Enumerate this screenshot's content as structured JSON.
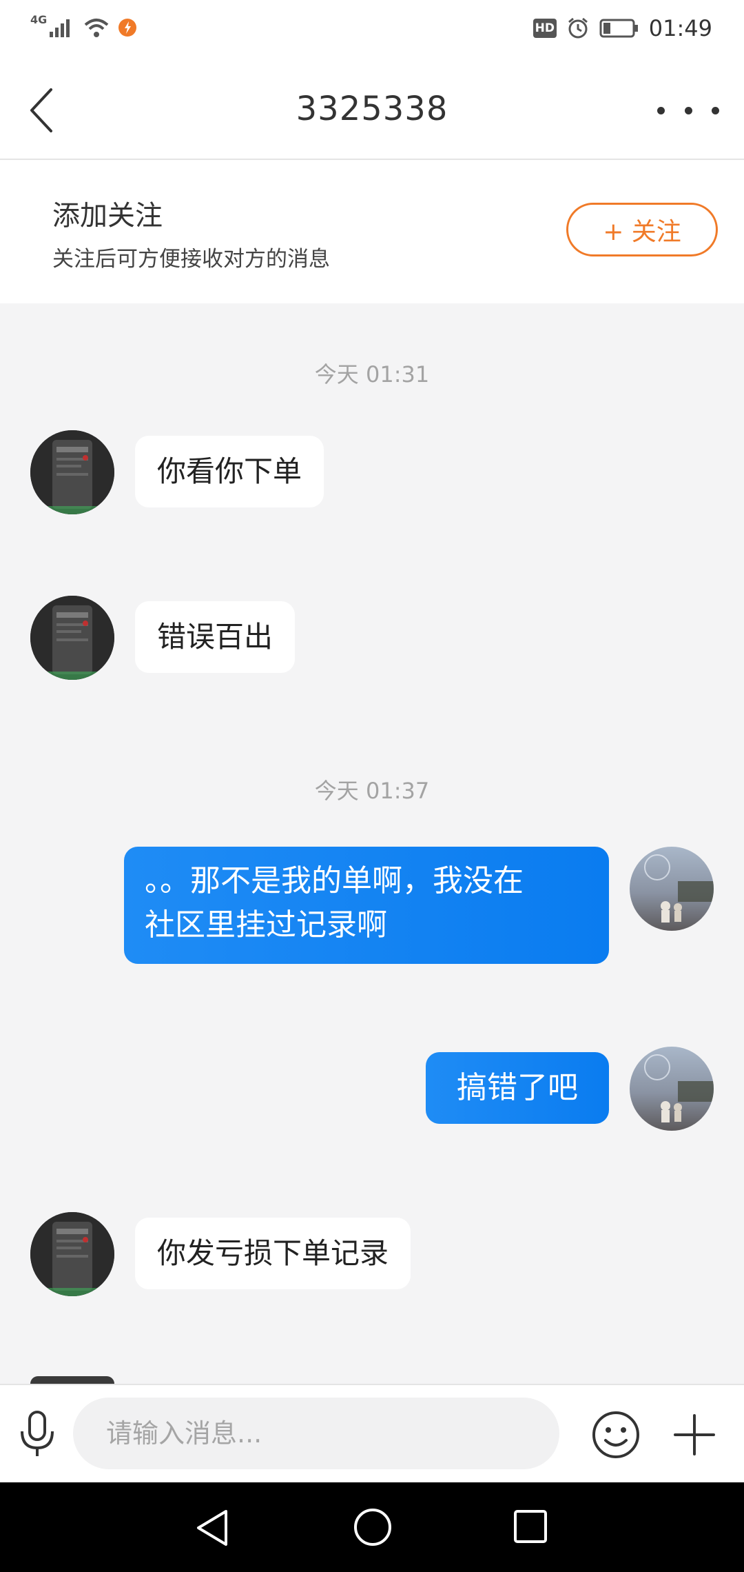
{
  "status_bar": {
    "network": "4G",
    "hd_badge": "HD",
    "time": "01:49",
    "icons": [
      "signal-icon",
      "wifi-icon",
      "app-notification-icon",
      "alarm-icon",
      "battery-icon"
    ]
  },
  "header": {
    "title": "3325338",
    "icons": [
      "back-arrow-icon",
      "more-options-icon"
    ]
  },
  "follow_panel": {
    "title": "添加关注",
    "subtitle": "关注后可方便接收对方的消息",
    "button_label": "+ 关注",
    "accent_color": "#f07a28"
  },
  "messages": [
    {
      "type": "timestamp",
      "text": "今天 01:31"
    },
    {
      "type": "incoming",
      "text": "你看你下单"
    },
    {
      "type": "incoming",
      "text": "错误百出"
    },
    {
      "type": "timestamp",
      "text": "今天 01:37"
    },
    {
      "type": "outgoing",
      "lines": [
        "。。那不是我的单啊，我没在",
        "社区里挂过记录啊"
      ]
    },
    {
      "type": "outgoing",
      "text": "搞错了吧"
    },
    {
      "type": "incoming",
      "text": "你发亏损下单记录"
    }
  ],
  "input_bar": {
    "placeholder": "请输入消息...",
    "icons": [
      "microphone-icon",
      "emoji-icon",
      "plus-icon"
    ]
  },
  "nav_bar": {
    "icons": [
      "nav-back-icon",
      "nav-home-icon",
      "nav-recents-icon"
    ]
  },
  "colors": {
    "outgoing_bubble": "#1a88f3",
    "incoming_bubble": "#ffffff",
    "chat_background": "#f4f4f5"
  }
}
